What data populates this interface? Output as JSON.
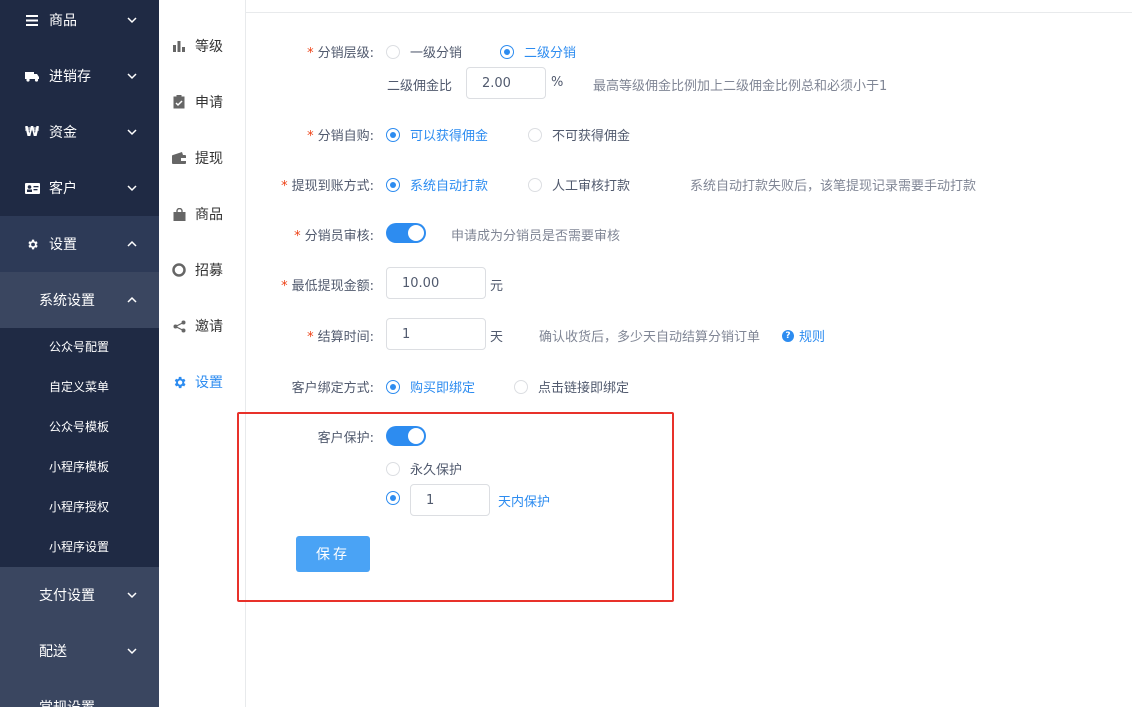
{
  "sidebar": {
    "items": [
      {
        "label": "商品",
        "icon": "menu-icon"
      },
      {
        "label": "进销存",
        "icon": "truck-icon"
      },
      {
        "label": "资金",
        "icon": "won-icon"
      },
      {
        "label": "客户",
        "icon": "id-card-icon"
      },
      {
        "label": "设置",
        "icon": "gear-icon"
      }
    ],
    "system_settings": "系统设置",
    "sub_items": [
      "公众号配置",
      "自定义菜单",
      "公众号模板",
      "小程序模板",
      "小程序授权",
      "小程序设置"
    ],
    "lower_items": [
      "支付设置",
      "配送",
      "常规设置"
    ]
  },
  "submenu": {
    "items": [
      {
        "label": "等级",
        "icon": "bar-chart-icon"
      },
      {
        "label": "申请",
        "icon": "clipboard-icon"
      },
      {
        "label": "提现",
        "icon": "wallet-icon"
      },
      {
        "label": "商品",
        "icon": "bag-icon"
      },
      {
        "label": "招募",
        "icon": "lifebuoy-icon"
      },
      {
        "label": "邀请",
        "icon": "share-icon"
      },
      {
        "label": "设置",
        "icon": "gear-icon"
      }
    ],
    "active": "设置"
  },
  "form": {
    "level": {
      "label": "分销层级:",
      "options": [
        "一级分销",
        "二级分销"
      ],
      "selected": "二级分销",
      "commission_label": "二级佣金比",
      "commission_value": "2.00",
      "commission_unit": "%",
      "commission_hint": "最高等级佣金比例加上二级佣金比例总和必须小于1"
    },
    "self_purchase": {
      "label": "分销自购:",
      "options": [
        "可以获得佣金",
        "不可获得佣金"
      ],
      "selected": "可以获得佣金"
    },
    "withdraw": {
      "label": "提现到账方式:",
      "options": [
        "系统自动打款",
        "人工审核打款"
      ],
      "selected": "系统自动打款",
      "hint": "系统自动打款失败后，该笔提现记录需要手动打款"
    },
    "audit": {
      "label": "分销员审核:",
      "enabled": true,
      "hint": "申请成为分销员是否需要审核"
    },
    "min_withdraw": {
      "label": "最低提现金额:",
      "value": "10.00",
      "unit": "元"
    },
    "settle_time": {
      "label": "结算时间:",
      "value": "1",
      "unit": "天",
      "hint": "确认收货后，多少天自动结算分销订单",
      "rule_link": "规则"
    },
    "bind": {
      "label": "客户绑定方式:",
      "options": [
        "购买即绑定",
        "点击链接即绑定"
      ],
      "selected": "购买即绑定"
    },
    "protect": {
      "label": "客户保护:",
      "enabled": true,
      "option_forever": "永久保护",
      "days_value": "1",
      "days_suffix": "天内保护",
      "selected": "days"
    },
    "save_label": "保存"
  },
  "colors": {
    "sidebar_bg": "#1f2a44",
    "primary": "#2d8cf0",
    "highlight_border": "#e8312a"
  }
}
